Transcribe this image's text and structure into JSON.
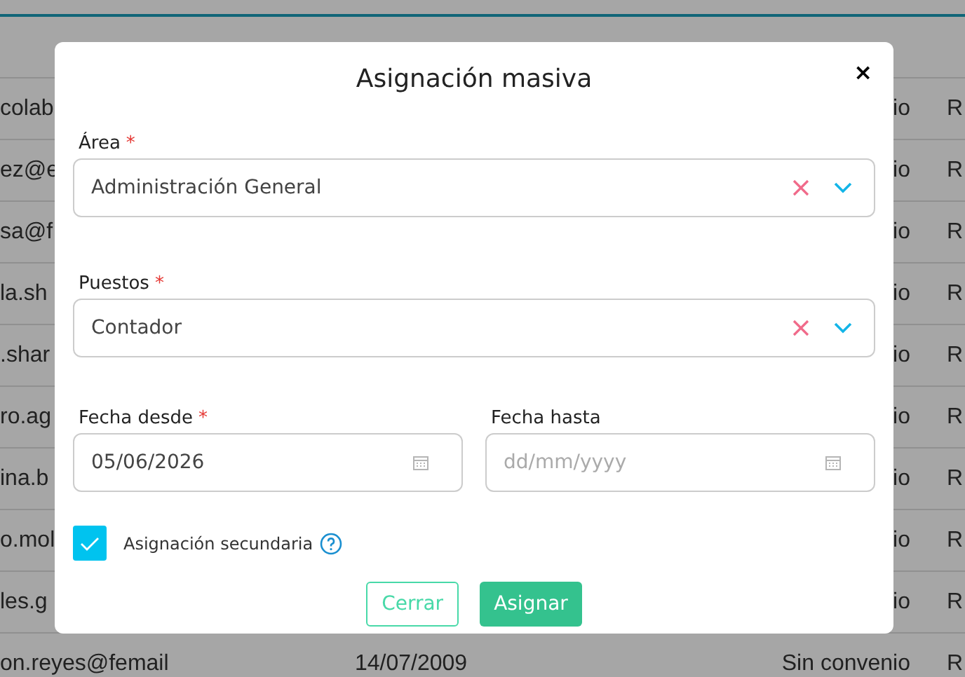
{
  "table": {
    "rows": [
      {
        "column_1": "colab",
        "column_3": "io",
        "column_4": "R"
      },
      {
        "column_1": "ez@e",
        "column_3": "io",
        "column_4": "R"
      },
      {
        "column_1": "sa@f",
        "column_3": "io",
        "column_4": "R"
      },
      {
        "column_1": "la.sh",
        "column_3": "io",
        "column_4": "R"
      },
      {
        "column_1": ".shar",
        "column_3": "io",
        "column_4": "R"
      },
      {
        "column_1": "ro.ag",
        "column_3": "io",
        "column_4": "R"
      },
      {
        "column_1": "ina.b",
        "column_3": "io",
        "column_4": "R"
      },
      {
        "column_1": "o.mol",
        "column_3": "io",
        "column_4": "R"
      },
      {
        "column_1": "les.g",
        "column_3": "io",
        "column_4": "R"
      },
      {
        "column_1": "on.reyes@femail",
        "column_2": "14/07/2009",
        "column_3": "Sin convenio",
        "column_4": "R"
      }
    ]
  },
  "dialog": {
    "title": "Asignación masiva",
    "close": "×",
    "fields": [
      {
        "kind": "select",
        "label": "Área",
        "required": "*",
        "value": "Administración General"
      },
      {
        "kind": "select",
        "label": "Puestos",
        "required": "*",
        "value": "Contador"
      }
    ],
    "dates": [
      {
        "label": "Fecha desde",
        "required": "*",
        "value": "05/06/2026"
      },
      {
        "label": "Fecha hasta",
        "placeholder": "dd/mm/yyyy"
      }
    ],
    "checkbox": {
      "label": "Asignación secundaria",
      "checked": true
    },
    "buttons": [
      {
        "label": "Cerrar",
        "kind": "secondary"
      },
      {
        "label": "Asignar",
        "kind": "primary"
      }
    ]
  }
}
